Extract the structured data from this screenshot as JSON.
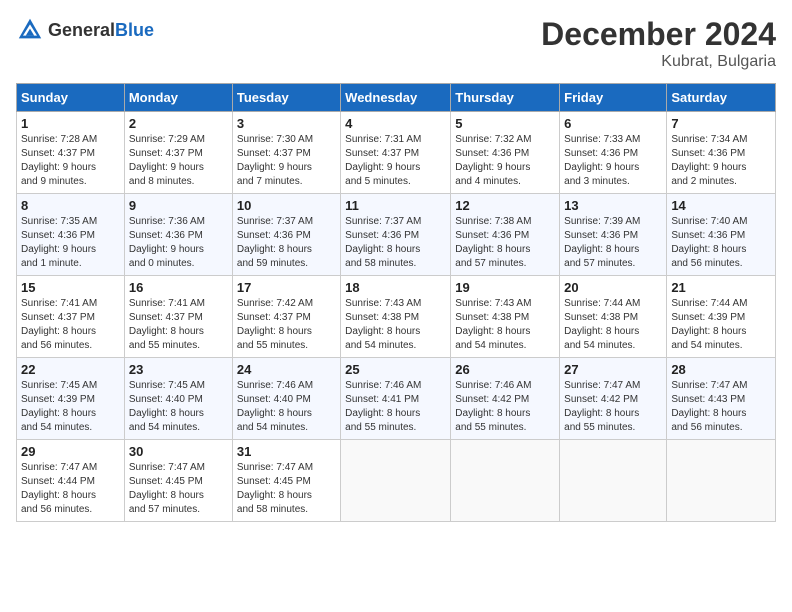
{
  "header": {
    "logo_general": "General",
    "logo_blue": "Blue",
    "title": "December 2024",
    "subtitle": "Kubrat, Bulgaria"
  },
  "calendar": {
    "weekdays": [
      "Sunday",
      "Monday",
      "Tuesday",
      "Wednesday",
      "Thursday",
      "Friday",
      "Saturday"
    ],
    "weeks": [
      [
        {
          "day": "1",
          "lines": [
            "Sunrise: 7:28 AM",
            "Sunset: 4:37 PM",
            "Daylight: 9 hours",
            "and 9 minutes."
          ]
        },
        {
          "day": "2",
          "lines": [
            "Sunrise: 7:29 AM",
            "Sunset: 4:37 PM",
            "Daylight: 9 hours",
            "and 8 minutes."
          ]
        },
        {
          "day": "3",
          "lines": [
            "Sunrise: 7:30 AM",
            "Sunset: 4:37 PM",
            "Daylight: 9 hours",
            "and 7 minutes."
          ]
        },
        {
          "day": "4",
          "lines": [
            "Sunrise: 7:31 AM",
            "Sunset: 4:37 PM",
            "Daylight: 9 hours",
            "and 5 minutes."
          ]
        },
        {
          "day": "5",
          "lines": [
            "Sunrise: 7:32 AM",
            "Sunset: 4:36 PM",
            "Daylight: 9 hours",
            "and 4 minutes."
          ]
        },
        {
          "day": "6",
          "lines": [
            "Sunrise: 7:33 AM",
            "Sunset: 4:36 PM",
            "Daylight: 9 hours",
            "and 3 minutes."
          ]
        },
        {
          "day": "7",
          "lines": [
            "Sunrise: 7:34 AM",
            "Sunset: 4:36 PM",
            "Daylight: 9 hours",
            "and 2 minutes."
          ]
        }
      ],
      [
        {
          "day": "8",
          "lines": [
            "Sunrise: 7:35 AM",
            "Sunset: 4:36 PM",
            "Daylight: 9 hours",
            "and 1 minute."
          ]
        },
        {
          "day": "9",
          "lines": [
            "Sunrise: 7:36 AM",
            "Sunset: 4:36 PM",
            "Daylight: 9 hours",
            "and 0 minutes."
          ]
        },
        {
          "day": "10",
          "lines": [
            "Sunrise: 7:37 AM",
            "Sunset: 4:36 PM",
            "Daylight: 8 hours",
            "and 59 minutes."
          ]
        },
        {
          "day": "11",
          "lines": [
            "Sunrise: 7:37 AM",
            "Sunset: 4:36 PM",
            "Daylight: 8 hours",
            "and 58 minutes."
          ]
        },
        {
          "day": "12",
          "lines": [
            "Sunrise: 7:38 AM",
            "Sunset: 4:36 PM",
            "Daylight: 8 hours",
            "and 57 minutes."
          ]
        },
        {
          "day": "13",
          "lines": [
            "Sunrise: 7:39 AM",
            "Sunset: 4:36 PM",
            "Daylight: 8 hours",
            "and 57 minutes."
          ]
        },
        {
          "day": "14",
          "lines": [
            "Sunrise: 7:40 AM",
            "Sunset: 4:36 PM",
            "Daylight: 8 hours",
            "and 56 minutes."
          ]
        }
      ],
      [
        {
          "day": "15",
          "lines": [
            "Sunrise: 7:41 AM",
            "Sunset: 4:37 PM",
            "Daylight: 8 hours",
            "and 56 minutes."
          ]
        },
        {
          "day": "16",
          "lines": [
            "Sunrise: 7:41 AM",
            "Sunset: 4:37 PM",
            "Daylight: 8 hours",
            "and 55 minutes."
          ]
        },
        {
          "day": "17",
          "lines": [
            "Sunrise: 7:42 AM",
            "Sunset: 4:37 PM",
            "Daylight: 8 hours",
            "and 55 minutes."
          ]
        },
        {
          "day": "18",
          "lines": [
            "Sunrise: 7:43 AM",
            "Sunset: 4:38 PM",
            "Daylight: 8 hours",
            "and 54 minutes."
          ]
        },
        {
          "day": "19",
          "lines": [
            "Sunrise: 7:43 AM",
            "Sunset: 4:38 PM",
            "Daylight: 8 hours",
            "and 54 minutes."
          ]
        },
        {
          "day": "20",
          "lines": [
            "Sunrise: 7:44 AM",
            "Sunset: 4:38 PM",
            "Daylight: 8 hours",
            "and 54 minutes."
          ]
        },
        {
          "day": "21",
          "lines": [
            "Sunrise: 7:44 AM",
            "Sunset: 4:39 PM",
            "Daylight: 8 hours",
            "and 54 minutes."
          ]
        }
      ],
      [
        {
          "day": "22",
          "lines": [
            "Sunrise: 7:45 AM",
            "Sunset: 4:39 PM",
            "Daylight: 8 hours",
            "and 54 minutes."
          ]
        },
        {
          "day": "23",
          "lines": [
            "Sunrise: 7:45 AM",
            "Sunset: 4:40 PM",
            "Daylight: 8 hours",
            "and 54 minutes."
          ]
        },
        {
          "day": "24",
          "lines": [
            "Sunrise: 7:46 AM",
            "Sunset: 4:40 PM",
            "Daylight: 8 hours",
            "and 54 minutes."
          ]
        },
        {
          "day": "25",
          "lines": [
            "Sunrise: 7:46 AM",
            "Sunset: 4:41 PM",
            "Daylight: 8 hours",
            "and 55 minutes."
          ]
        },
        {
          "day": "26",
          "lines": [
            "Sunrise: 7:46 AM",
            "Sunset: 4:42 PM",
            "Daylight: 8 hours",
            "and 55 minutes."
          ]
        },
        {
          "day": "27",
          "lines": [
            "Sunrise: 7:47 AM",
            "Sunset: 4:42 PM",
            "Daylight: 8 hours",
            "and 55 minutes."
          ]
        },
        {
          "day": "28",
          "lines": [
            "Sunrise: 7:47 AM",
            "Sunset: 4:43 PM",
            "Daylight: 8 hours",
            "and 56 minutes."
          ]
        }
      ],
      [
        {
          "day": "29",
          "lines": [
            "Sunrise: 7:47 AM",
            "Sunset: 4:44 PM",
            "Daylight: 8 hours",
            "and 56 minutes."
          ]
        },
        {
          "day": "30",
          "lines": [
            "Sunrise: 7:47 AM",
            "Sunset: 4:45 PM",
            "Daylight: 8 hours",
            "and 57 minutes."
          ]
        },
        {
          "day": "31",
          "lines": [
            "Sunrise: 7:47 AM",
            "Sunset: 4:45 PM",
            "Daylight: 8 hours",
            "and 58 minutes."
          ]
        },
        null,
        null,
        null,
        null
      ]
    ]
  }
}
